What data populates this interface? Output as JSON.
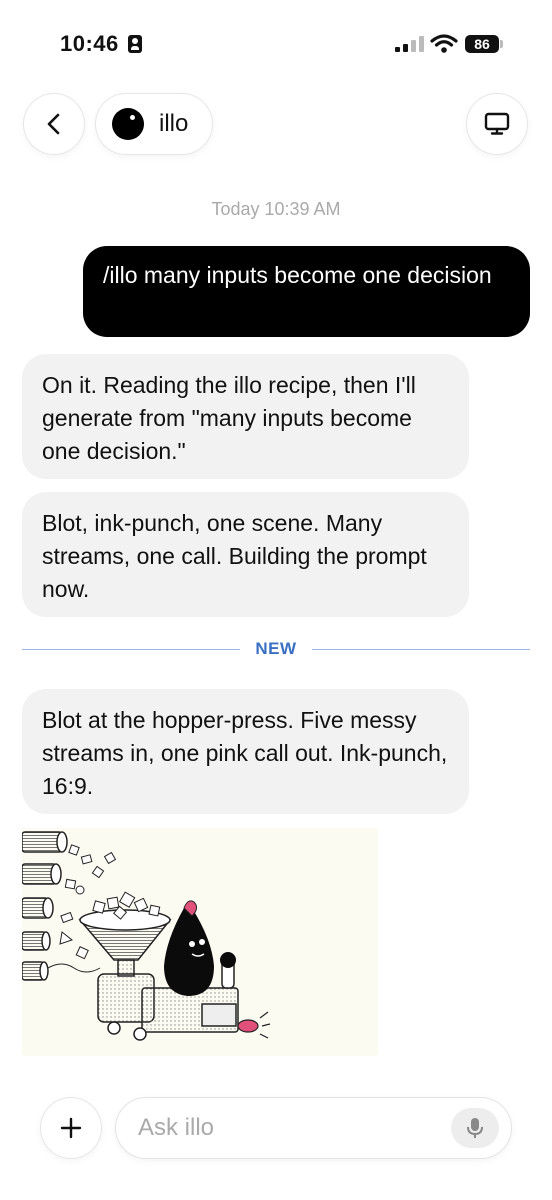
{
  "status_bar": {
    "time": "10:46",
    "battery": "86"
  },
  "header": {
    "title": "illo"
  },
  "chat": {
    "timestamp": "Today 10:39 AM",
    "user_message": "/illo many inputs become one decision",
    "bot_messages": [
      "On it. Reading the illo recipe, then I'll generate from \"many inputs become one decision.\"",
      "Blot, ink-punch, one scene. Many streams, one call. Building the prompt now.",
      "Blot at the hopper-press. Five messy streams in, one pink call out. Ink-punch, 16:9."
    ],
    "divider_label": "NEW"
  },
  "composer": {
    "placeholder": "Ask illo"
  },
  "icons": {
    "back": "chevron-left-icon",
    "desktop": "monitor-icon",
    "plus": "plus-icon",
    "mic": "microphone-icon"
  },
  "colors": {
    "user_bubble": "#000000",
    "bot_bubble": "#f2f2f2",
    "new_label": "#3a6fc2",
    "accent_pink": "#e0507a"
  }
}
